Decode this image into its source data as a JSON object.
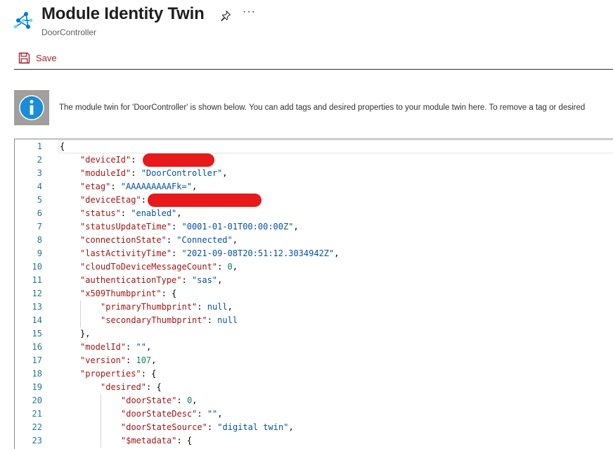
{
  "header": {
    "title": "Module Identity Twin",
    "subtitle": "DoorController",
    "more_label": "···",
    "icons": {
      "app": "iot-hub-icon",
      "pin": "pin-icon",
      "more": "more-icon"
    }
  },
  "toolbar": {
    "save_label": "Save",
    "save_icon": "save-icon",
    "accent": "#a4262c"
  },
  "info": {
    "icon": "info-icon",
    "text": "The module twin for 'DoorController' is shown below. You can add tags and desired properties to your module twin here. To remove a tag or desired"
  },
  "editor": {
    "lines": [
      {
        "n": "1",
        "indent": 0,
        "parts": [
          [
            "p",
            "{"
          ]
        ]
      },
      {
        "n": "2",
        "indent": 1,
        "parts": [
          [
            "k",
            "\"deviceId\""
          ],
          [
            "p",
            ": "
          ]
        ],
        "redacted": true
      },
      {
        "n": "3",
        "indent": 1,
        "parts": [
          [
            "k",
            "\"moduleId\""
          ],
          [
            "p",
            ": "
          ],
          [
            "s",
            "\"DoorController\""
          ],
          [
            "p",
            ","
          ]
        ]
      },
      {
        "n": "4",
        "indent": 1,
        "parts": [
          [
            "k",
            "\"etag\""
          ],
          [
            "p",
            ": "
          ],
          [
            "s",
            "\"AAAAAAAAAFk=\""
          ],
          [
            "p",
            ","
          ]
        ]
      },
      {
        "n": "5",
        "indent": 1,
        "parts": [
          [
            "k",
            "\"deviceEtag\""
          ],
          [
            "p",
            ":"
          ]
        ],
        "redacted": true
      },
      {
        "n": "6",
        "indent": 1,
        "parts": [
          [
            "k",
            "\"status\""
          ],
          [
            "p",
            ": "
          ],
          [
            "s",
            "\"enabled\""
          ],
          [
            "p",
            ","
          ]
        ]
      },
      {
        "n": "7",
        "indent": 1,
        "parts": [
          [
            "k",
            "\"statusUpdateTime\""
          ],
          [
            "p",
            ": "
          ],
          [
            "s",
            "\"0001-01-01T00:00:00Z\""
          ],
          [
            "p",
            ","
          ]
        ]
      },
      {
        "n": "8",
        "indent": 1,
        "parts": [
          [
            "k",
            "\"connectionState\""
          ],
          [
            "p",
            ": "
          ],
          [
            "s",
            "\"Connected\""
          ],
          [
            "p",
            ","
          ]
        ]
      },
      {
        "n": "9",
        "indent": 1,
        "parts": [
          [
            "k",
            "\"lastActivityTime\""
          ],
          [
            "p",
            ": "
          ],
          [
            "s",
            "\"2021-09-08T20:51:12.3034942Z\""
          ],
          [
            "p",
            ","
          ]
        ]
      },
      {
        "n": "10",
        "indent": 1,
        "parts": [
          [
            "k",
            "\"cloudToDeviceMessageCount\""
          ],
          [
            "p",
            ": "
          ],
          [
            "n",
            "0"
          ],
          [
            "p",
            ","
          ]
        ]
      },
      {
        "n": "11",
        "indent": 1,
        "parts": [
          [
            "k",
            "\"authenticationType\""
          ],
          [
            "p",
            ": "
          ],
          [
            "s",
            "\"sas\""
          ],
          [
            "p",
            ","
          ]
        ]
      },
      {
        "n": "12",
        "indent": 1,
        "parts": [
          [
            "k",
            "\"x509Thumbprint\""
          ],
          [
            "p",
            ": {"
          ]
        ]
      },
      {
        "n": "13",
        "indent": 2,
        "parts": [
          [
            "k",
            "\"primaryThumbprint\""
          ],
          [
            "p",
            ": "
          ],
          [
            "s",
            "null"
          ],
          [
            "p",
            ","
          ]
        ]
      },
      {
        "n": "14",
        "indent": 2,
        "parts": [
          [
            "k",
            "\"secondaryThumbprint\""
          ],
          [
            "p",
            ": "
          ],
          [
            "s",
            "null"
          ]
        ]
      },
      {
        "n": "15",
        "indent": 1,
        "parts": [
          [
            "p",
            "},"
          ]
        ]
      },
      {
        "n": "16",
        "indent": 1,
        "parts": [
          [
            "k",
            "\"modelId\""
          ],
          [
            "p",
            ": "
          ],
          [
            "s",
            "\"\""
          ],
          [
            "p",
            ","
          ]
        ]
      },
      {
        "n": "17",
        "indent": 1,
        "parts": [
          [
            "k",
            "\"version\""
          ],
          [
            "p",
            ": "
          ],
          [
            "n",
            "107"
          ],
          [
            "p",
            ","
          ]
        ]
      },
      {
        "n": "18",
        "indent": 1,
        "parts": [
          [
            "k",
            "\"properties\""
          ],
          [
            "p",
            ": {"
          ]
        ]
      },
      {
        "n": "19",
        "indent": 2,
        "parts": [
          [
            "k",
            "\"desired\""
          ],
          [
            "p",
            ": {"
          ]
        ]
      },
      {
        "n": "20",
        "indent": 3,
        "parts": [
          [
            "k",
            "\"doorState\""
          ],
          [
            "p",
            ": "
          ],
          [
            "n",
            "0"
          ],
          [
            "p",
            ","
          ]
        ]
      },
      {
        "n": "21",
        "indent": 3,
        "parts": [
          [
            "k",
            "\"doorStateDesc\""
          ],
          [
            "p",
            ": "
          ],
          [
            "s",
            "\"\""
          ],
          [
            "p",
            ","
          ]
        ]
      },
      {
        "n": "22",
        "indent": 3,
        "parts": [
          [
            "k",
            "\"doorStateSource\""
          ],
          [
            "p",
            ": "
          ],
          [
            "s",
            "\"digital twin\""
          ],
          [
            "p",
            ","
          ]
        ]
      },
      {
        "n": "23",
        "indent": 3,
        "parts": [
          [
            "k",
            "\"$metadata\""
          ],
          [
            "p",
            ": {"
          ]
        ]
      }
    ]
  }
}
